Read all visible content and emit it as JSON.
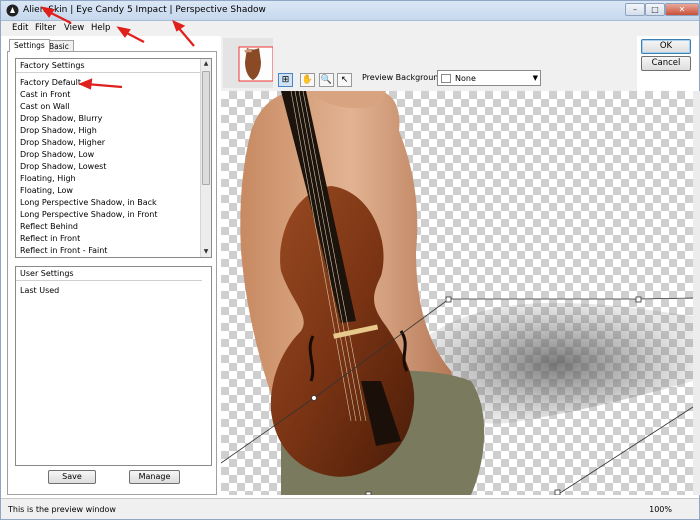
{
  "title": "Alien Skin | Eye Candy 5 Impact | Perspective Shadow",
  "window_controls": {
    "minimize": "–",
    "maximize": "□",
    "close": "✕"
  },
  "menu": [
    "Edit",
    "Filter",
    "View",
    "Help"
  ],
  "tabs": [
    "Settings",
    "Basic"
  ],
  "factory": {
    "header": "Factory Settings",
    "items": [
      "Factory Default",
      "Cast in Front",
      "Cast on Wall",
      "Drop Shadow, Blurry",
      "Drop Shadow, High",
      "Drop Shadow, Higher",
      "Drop Shadow, Low",
      "Drop Shadow, Lowest",
      "Floating, High",
      "Floating, Low",
      "Long Perspective Shadow, in Back",
      "Long Perspective Shadow, in Front",
      "Reflect Behind",
      "Reflect in Front",
      "Reflect in Front - Faint"
    ]
  },
  "user": {
    "header": "User Settings",
    "items": [
      "Last Used"
    ]
  },
  "buttons": {
    "save": "Save",
    "manage": "Manage",
    "ok": "OK",
    "cancel": "Cancel"
  },
  "preview_bg": {
    "label": "Preview Background:",
    "value": "None"
  },
  "status": {
    "text": "This is the preview window",
    "zoom": "100%"
  },
  "colors": {
    "annotation_arrow": "#e0201c",
    "selection": "#3c7fb1"
  }
}
